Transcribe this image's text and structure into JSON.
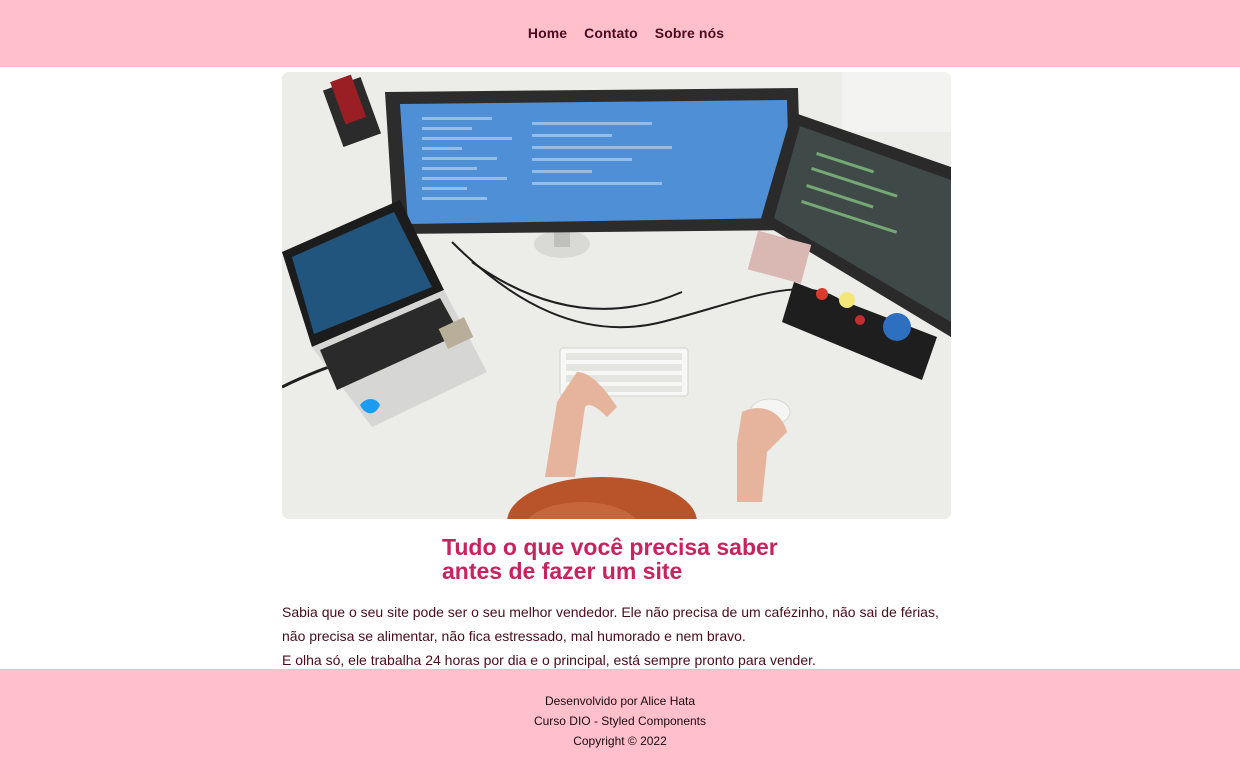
{
  "nav": {
    "items": [
      {
        "label": "Home"
      },
      {
        "label": "Contato"
      },
      {
        "label": "Sobre nós"
      }
    ]
  },
  "hero": {
    "image": "desk-workspace-photo"
  },
  "article": {
    "title_line1": "Tudo o que você precisa saber",
    "title_line2": "antes de fazer um site",
    "paragraph1": "Sabia que o seu site pode ser o seu melhor vendedor. Ele não precisa de um cafézinho, não sai de férias, não precisa se alimentar, não fica estressado, mal humorado e nem bravo.",
    "paragraph2": "E olha só, ele trabalha 24 horas por dia e o principal, está sempre pronto para vender."
  },
  "footer": {
    "line1": "Desenvolvido por Alice Hata",
    "line2": "Curso DIO - Styled Components",
    "line3": "Copyright © 2022"
  },
  "colors": {
    "bar_background": "#ffc0cb",
    "title": "#c9225f",
    "nav_text": "#4a0b1d"
  }
}
